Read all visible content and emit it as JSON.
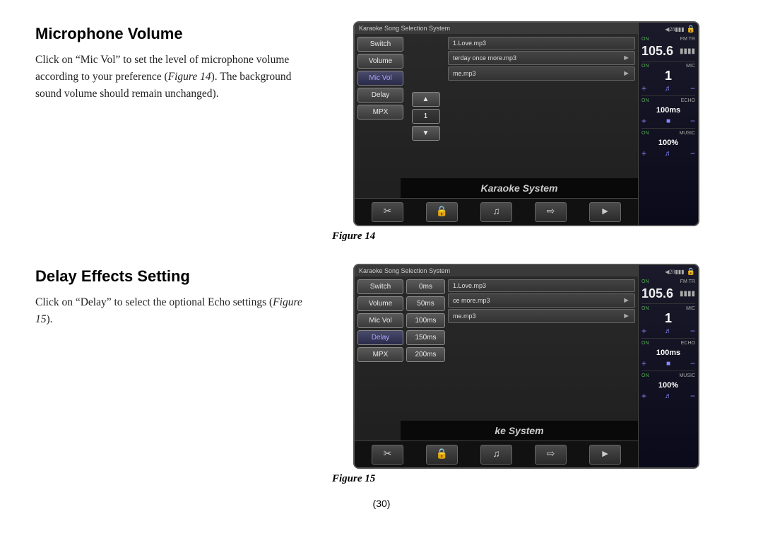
{
  "page": {
    "number": "(30)"
  },
  "section1": {
    "title": "Microphone Volume",
    "body_line1": "Click on “Mic Vol” to set the level",
    "body_line2": "of microphone volume according to",
    "body_line3": "your preference (",
    "figure_ref1": "Figure 14",
    "body_line4": "). The",
    "body_line5": "background sound volume should",
    "body_line6": "remain unchanged).",
    "figure_caption": "Figure 14"
  },
  "section2": {
    "title": "Delay Effects Setting",
    "body_line1": "Click on “Delay” to select the",
    "body_line2": "optional Echo settings (",
    "figure_ref": "Figure",
    "body_line3": "15",
    "body_line4": ").",
    "figure_caption": "Figure 15"
  },
  "device": {
    "screen_title": "Karaoke Song Selection System",
    "song1": "1.Love.mp3",
    "song2": "terday once more.mp3",
    "song3": "me.mp3",
    "karaoke_label": "Karaoke System",
    "buttons": {
      "switch": "Switch",
      "volume": "Volume",
      "mic_vol": "Mic Vol",
      "delay": "Delay",
      "mpx": "MPX"
    },
    "mic_value": "1",
    "right_panel": {
      "battery": "◄28▐▐▐",
      "lock": "🔒",
      "on_label": "ON",
      "fm_tr": "FM TR",
      "freq": "105.6",
      "signal_bars": "▐▐▐▐",
      "mic_on": "ON",
      "mic_label": "MIC",
      "mic_value": "1",
      "echo_on": "ON",
      "echo_label": "ECHO",
      "echo_value": "100ms",
      "music_on": "ON",
      "music_label": "MUSIC",
      "music_value": "100%"
    }
  },
  "device2": {
    "screen_title": "Karaoke Song Selection System",
    "song1": "1.Love.mp3",
    "song2": "ce more.mp3",
    "song3": "me.mp3",
    "karaoke_label": "ke System",
    "buttons": {
      "switch": "Switch",
      "volume": "Volume",
      "mic_vol": "Mic Vol",
      "delay": "Delay",
      "mpx": "MPX"
    },
    "delay_options": [
      "0ms",
      "50ms",
      "100ms",
      "150ms",
      "200ms"
    ],
    "right_panel": {
      "battery": "◄28▐▐▐",
      "lock": "🔒",
      "on_label": "ON",
      "fm_tr": "FM TR",
      "freq": "105.6",
      "mic_on": "ON",
      "mic_label": "MIC",
      "mic_value": "1",
      "echo_on": "ON",
      "echo_label": "ECHO",
      "echo_value": "100ms",
      "music_on": "ON",
      "music_label": "MUSIC",
      "music_value": "100%"
    }
  }
}
